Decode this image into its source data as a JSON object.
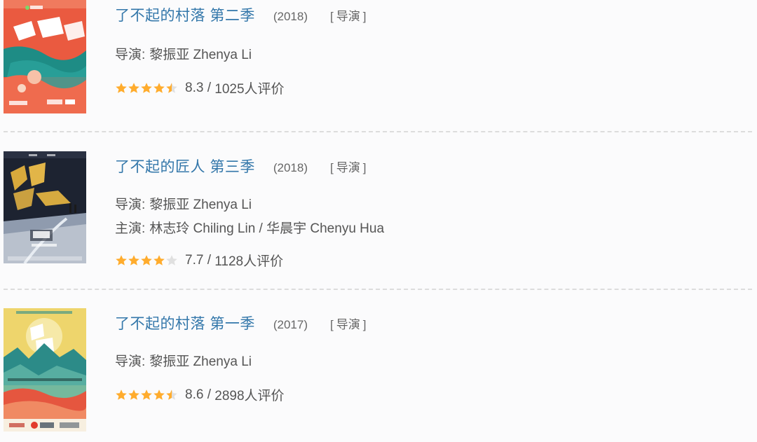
{
  "items": [
    {
      "title": "了不起的村落 第二季",
      "year": "(2018)",
      "role": "导演",
      "director_label": "导演:",
      "director": "黎振亚 Zhenya Li",
      "stars": 4.5,
      "score": "8.3",
      "votes": "1025人评价",
      "poster": {
        "colors": [
          "#e8503a",
          "#1f8f86",
          "#f3b8a2"
        ],
        "icon": "poster-village-s2"
      }
    },
    {
      "title": "了不起的匠人 第三季",
      "year": "(2018)",
      "role": "导演",
      "director_label": "导演:",
      "director": "黎振亚 Zhenya Li",
      "cast_label": "主演:",
      "cast": "林志玲 Chiling Lin / 华晨宇 Chenyu Hua",
      "stars": 4,
      "score": "7.7",
      "votes": "1128人评价",
      "poster": {
        "colors": [
          "#1c2230",
          "#d6a53a",
          "#8a96a8"
        ],
        "icon": "poster-craftsman-s3"
      }
    },
    {
      "title": "了不起的村落 第一季",
      "year": "(2017)",
      "role": "导演",
      "director_label": "导演:",
      "director": "黎振亚 Zhenya Li",
      "stars": 4.5,
      "score": "8.6",
      "votes": "2898人评价",
      "poster": {
        "colors": [
          "#efd56a",
          "#2d8e8a",
          "#e0553f"
        ],
        "icon": "poster-village-s1"
      }
    }
  ],
  "colors": {
    "title": "#3377aa",
    "star_on": "#ffac2d",
    "star_off": "#e0e0e0",
    "divider": "#dcdcdc"
  }
}
